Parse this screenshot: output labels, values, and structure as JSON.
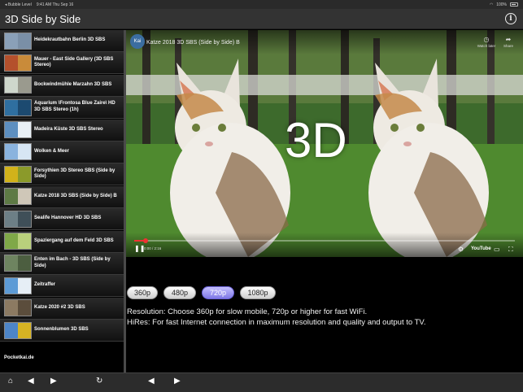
{
  "status_bar": {
    "back_label": "◂ Bubble Level",
    "time": "9:41 AM   Thu Sep 16",
    "battery": "100%"
  },
  "header": {
    "title": "3D Side by Side",
    "info_icon": "info-circle-icon"
  },
  "sidebar": {
    "items": [
      {
        "label": "Heidekrautbahn Berlin 3D SBS",
        "colors": [
          "#8aa0b8",
          "#7a8fa6"
        ]
      },
      {
        "label": "Mauer - East Side Gallery (3D SBS Stereo)",
        "colors": [
          "#b4502c",
          "#c98b3a"
        ]
      },
      {
        "label": "Bockwindmühle Marzahn 3D SBS",
        "colors": [
          "#cfd7cc",
          "#9a9a8e"
        ]
      },
      {
        "label": "Aquarium \\Frontosa Blue Zaire\\ HD 3D SBS Stereo (1h)",
        "colors": [
          "#2f6fa0",
          "#1c4a70"
        ]
      },
      {
        "label": "Madeira Küste 3D SBS Stereo",
        "colors": [
          "#5d8fc0",
          "#e8f0f6"
        ]
      },
      {
        "label": "Wolken & Meer",
        "colors": [
          "#8ab3de",
          "#d7e6f4"
        ]
      },
      {
        "label": "Forsythien 3D Stereo SBS (Side by Side)",
        "colors": [
          "#d2b21a",
          "#8b9a2a"
        ]
      },
      {
        "label": "Katze 2018 3D SBS (Side by Side) B",
        "colors": [
          "#5e7a45",
          "#cfc7b8"
        ]
      },
      {
        "label": "Sealife Hannover HD 3D SBS",
        "colors": [
          "#6d7f86",
          "#3f4f58"
        ]
      },
      {
        "label": "Spaziergang auf dem Feld 3D SBS",
        "colors": [
          "#7fa848",
          "#b9d07c"
        ]
      },
      {
        "label": "Enten im Bach - 3D SBS (Side by Side)",
        "colors": [
          "#6e8460",
          "#4c5e40"
        ]
      },
      {
        "label": "Zeitraffer",
        "colors": [
          "#5d9bd6",
          "#e6eef6"
        ]
      },
      {
        "label": "Katze 2020 #2 3D SBS",
        "colors": [
          "#8c7a62",
          "#5b4d3c"
        ]
      },
      {
        "label": "Sonnenblumen 3D SBS",
        "colors": [
          "#4d85c8",
          "#d6b323"
        ]
      }
    ],
    "footer": "Pocketkai.de"
  },
  "video": {
    "channel_initials": "Kai",
    "title": "Katze 2018 3D SBS (Side by Side) B",
    "overlay": "3D",
    "watch_later": "Watch later",
    "share": "Share",
    "timecode": "0:00 / 2:16",
    "progress": 0.03,
    "youtube_label": "YouTube"
  },
  "resolution": {
    "buttons": [
      "360p",
      "480p",
      "720p",
      "1080p"
    ],
    "active": "720p",
    "line1": "Resolution: Choose 360p for slow mobile, 720p or higher for fast WiFi.",
    "line2": "HiRes: For fast Internet connection in maximum resolution and quality and output to TV."
  },
  "toolbar": {
    "home_icon": "home-icon",
    "back_icon": "back-arrow-icon",
    "forward_icon": "forward-arrow-icon",
    "reload_icon": "reload-icon"
  }
}
